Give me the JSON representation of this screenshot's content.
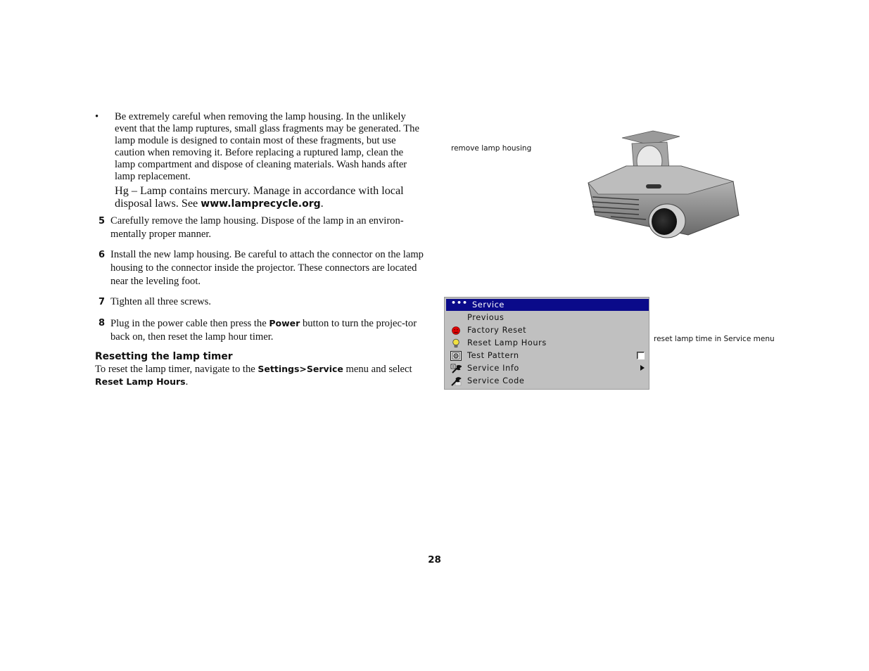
{
  "left_column": {
    "bullet_symbol": "•",
    "bullet_text": "Be extremely careful when removing the lamp housing. In the unlikely event that the lamp ruptures, small glass fragments may be generated. The lamp module is designed to contain most of these fragments, but use caution when removing it. Before replacing a ruptured lamp, clean the lamp compartment and dispose of cleaning materials. Wash hands after lamp replacement.",
    "hg_text": "Hg – Lamp contains mercury. Manage in accordance with local disposal laws. See ",
    "hg_link": "www.lamprecycle.org",
    "hg_end": ".",
    "steps": [
      {
        "number": "5",
        "text": "Carefully remove the lamp housing. Dispose of the lamp in an environ-mentally proper manner."
      },
      {
        "number": "6",
        "text": "Install the new lamp housing. Be careful to attach the connector on the lamp housing to the connector inside the projector. These connectors are located near the leveling foot."
      },
      {
        "number": "7",
        "text": "Tighten all three screws."
      },
      {
        "number": "8",
        "text_before": "Plug in the power cable then press the ",
        "bold": "Power",
        "text_after": " button to turn the projec-tor back on, then reset the lamp hour timer."
      }
    ],
    "section_heading": "Resetting the lamp timer",
    "section_para": {
      "text_before": "To reset the lamp timer, navigate to the ",
      "bold1": "Settings>Service",
      "text_middle": " menu and select ",
      "bold2": "Reset Lamp Hours",
      "text_after": "."
    }
  },
  "figures": {
    "projector_caption": "remove lamp housing",
    "menu_caption": "reset lamp time in Service menu"
  },
  "osd_menu": {
    "title_icon": "•••",
    "title": "Service",
    "colors": {
      "title_bg": "#0a0a8a",
      "menu_bg": "#c0c0c0",
      "factory_reset_icon": "#e00000",
      "lamp_icon": "#f0e040"
    },
    "items": [
      {
        "label": "Previous",
        "icon": "none",
        "control": "none"
      },
      {
        "label": "Factory Reset",
        "icon": "red-face-icon",
        "control": "none"
      },
      {
        "label": "Reset Lamp Hours",
        "icon": "light-bulb-icon",
        "control": "none"
      },
      {
        "label": "Test Pattern",
        "icon": "test-pattern-icon",
        "control": "checkbox",
        "checked": false
      },
      {
        "label": "Service Info",
        "icon": "wrench-info-icon",
        "control": "submenu-arrow"
      },
      {
        "label": "Service Code",
        "icon": "wrench-icon",
        "control": "none"
      }
    ]
  },
  "page_number": "28"
}
